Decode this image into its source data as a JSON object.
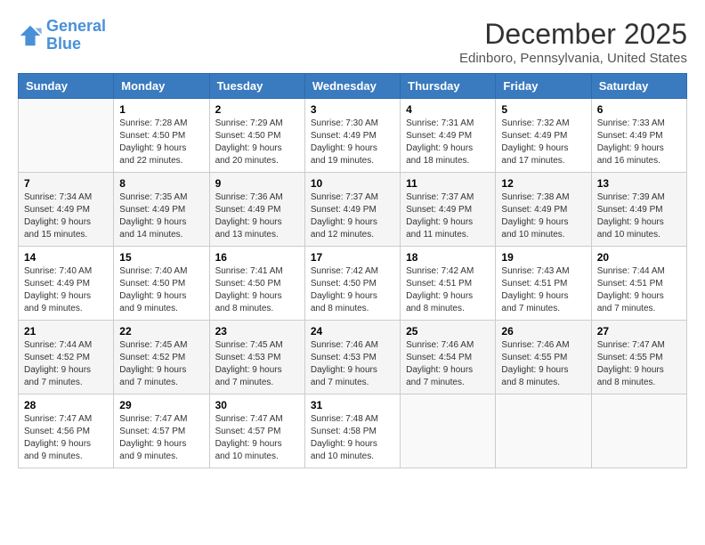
{
  "logo": {
    "line1": "General",
    "line2": "Blue"
  },
  "title": "December 2025",
  "subtitle": "Edinboro, Pennsylvania, United States",
  "days_of_week": [
    "Sunday",
    "Monday",
    "Tuesday",
    "Wednesday",
    "Thursday",
    "Friday",
    "Saturday"
  ],
  "weeks": [
    [
      {
        "day": "",
        "sunrise": "",
        "sunset": "",
        "daylight": ""
      },
      {
        "day": "1",
        "sunrise": "Sunrise: 7:28 AM",
        "sunset": "Sunset: 4:50 PM",
        "daylight": "Daylight: 9 hours and 22 minutes."
      },
      {
        "day": "2",
        "sunrise": "Sunrise: 7:29 AM",
        "sunset": "Sunset: 4:50 PM",
        "daylight": "Daylight: 9 hours and 20 minutes."
      },
      {
        "day": "3",
        "sunrise": "Sunrise: 7:30 AM",
        "sunset": "Sunset: 4:49 PM",
        "daylight": "Daylight: 9 hours and 19 minutes."
      },
      {
        "day": "4",
        "sunrise": "Sunrise: 7:31 AM",
        "sunset": "Sunset: 4:49 PM",
        "daylight": "Daylight: 9 hours and 18 minutes."
      },
      {
        "day": "5",
        "sunrise": "Sunrise: 7:32 AM",
        "sunset": "Sunset: 4:49 PM",
        "daylight": "Daylight: 9 hours and 17 minutes."
      },
      {
        "day": "6",
        "sunrise": "Sunrise: 7:33 AM",
        "sunset": "Sunset: 4:49 PM",
        "daylight": "Daylight: 9 hours and 16 minutes."
      }
    ],
    [
      {
        "day": "7",
        "sunrise": "Sunrise: 7:34 AM",
        "sunset": "Sunset: 4:49 PM",
        "daylight": "Daylight: 9 hours and 15 minutes."
      },
      {
        "day": "8",
        "sunrise": "Sunrise: 7:35 AM",
        "sunset": "Sunset: 4:49 PM",
        "daylight": "Daylight: 9 hours and 14 minutes."
      },
      {
        "day": "9",
        "sunrise": "Sunrise: 7:36 AM",
        "sunset": "Sunset: 4:49 PM",
        "daylight": "Daylight: 9 hours and 13 minutes."
      },
      {
        "day": "10",
        "sunrise": "Sunrise: 7:37 AM",
        "sunset": "Sunset: 4:49 PM",
        "daylight": "Daylight: 9 hours and 12 minutes."
      },
      {
        "day": "11",
        "sunrise": "Sunrise: 7:37 AM",
        "sunset": "Sunset: 4:49 PM",
        "daylight": "Daylight: 9 hours and 11 minutes."
      },
      {
        "day": "12",
        "sunrise": "Sunrise: 7:38 AM",
        "sunset": "Sunset: 4:49 PM",
        "daylight": "Daylight: 9 hours and 10 minutes."
      },
      {
        "day": "13",
        "sunrise": "Sunrise: 7:39 AM",
        "sunset": "Sunset: 4:49 PM",
        "daylight": "Daylight: 9 hours and 10 minutes."
      }
    ],
    [
      {
        "day": "14",
        "sunrise": "Sunrise: 7:40 AM",
        "sunset": "Sunset: 4:49 PM",
        "daylight": "Daylight: 9 hours and 9 minutes."
      },
      {
        "day": "15",
        "sunrise": "Sunrise: 7:40 AM",
        "sunset": "Sunset: 4:50 PM",
        "daylight": "Daylight: 9 hours and 9 minutes."
      },
      {
        "day": "16",
        "sunrise": "Sunrise: 7:41 AM",
        "sunset": "Sunset: 4:50 PM",
        "daylight": "Daylight: 9 hours and 8 minutes."
      },
      {
        "day": "17",
        "sunrise": "Sunrise: 7:42 AM",
        "sunset": "Sunset: 4:50 PM",
        "daylight": "Daylight: 9 hours and 8 minutes."
      },
      {
        "day": "18",
        "sunrise": "Sunrise: 7:42 AM",
        "sunset": "Sunset: 4:51 PM",
        "daylight": "Daylight: 9 hours and 8 minutes."
      },
      {
        "day": "19",
        "sunrise": "Sunrise: 7:43 AM",
        "sunset": "Sunset: 4:51 PM",
        "daylight": "Daylight: 9 hours and 7 minutes."
      },
      {
        "day": "20",
        "sunrise": "Sunrise: 7:44 AM",
        "sunset": "Sunset: 4:51 PM",
        "daylight": "Daylight: 9 hours and 7 minutes."
      }
    ],
    [
      {
        "day": "21",
        "sunrise": "Sunrise: 7:44 AM",
        "sunset": "Sunset: 4:52 PM",
        "daylight": "Daylight: 9 hours and 7 minutes."
      },
      {
        "day": "22",
        "sunrise": "Sunrise: 7:45 AM",
        "sunset": "Sunset: 4:52 PM",
        "daylight": "Daylight: 9 hours and 7 minutes."
      },
      {
        "day": "23",
        "sunrise": "Sunrise: 7:45 AM",
        "sunset": "Sunset: 4:53 PM",
        "daylight": "Daylight: 9 hours and 7 minutes."
      },
      {
        "day": "24",
        "sunrise": "Sunrise: 7:46 AM",
        "sunset": "Sunset: 4:53 PM",
        "daylight": "Daylight: 9 hours and 7 minutes."
      },
      {
        "day": "25",
        "sunrise": "Sunrise: 7:46 AM",
        "sunset": "Sunset: 4:54 PM",
        "daylight": "Daylight: 9 hours and 7 minutes."
      },
      {
        "day": "26",
        "sunrise": "Sunrise: 7:46 AM",
        "sunset": "Sunset: 4:55 PM",
        "daylight": "Daylight: 9 hours and 8 minutes."
      },
      {
        "day": "27",
        "sunrise": "Sunrise: 7:47 AM",
        "sunset": "Sunset: 4:55 PM",
        "daylight": "Daylight: 9 hours and 8 minutes."
      }
    ],
    [
      {
        "day": "28",
        "sunrise": "Sunrise: 7:47 AM",
        "sunset": "Sunset: 4:56 PM",
        "daylight": "Daylight: 9 hours and 9 minutes."
      },
      {
        "day": "29",
        "sunrise": "Sunrise: 7:47 AM",
        "sunset": "Sunset: 4:57 PM",
        "daylight": "Daylight: 9 hours and 9 minutes."
      },
      {
        "day": "30",
        "sunrise": "Sunrise: 7:47 AM",
        "sunset": "Sunset: 4:57 PM",
        "daylight": "Daylight: 9 hours and 10 minutes."
      },
      {
        "day": "31",
        "sunrise": "Sunrise: 7:48 AM",
        "sunset": "Sunset: 4:58 PM",
        "daylight": "Daylight: 9 hours and 10 minutes."
      },
      {
        "day": "",
        "sunrise": "",
        "sunset": "",
        "daylight": ""
      },
      {
        "day": "",
        "sunrise": "",
        "sunset": "",
        "daylight": ""
      },
      {
        "day": "",
        "sunrise": "",
        "sunset": "",
        "daylight": ""
      }
    ]
  ]
}
